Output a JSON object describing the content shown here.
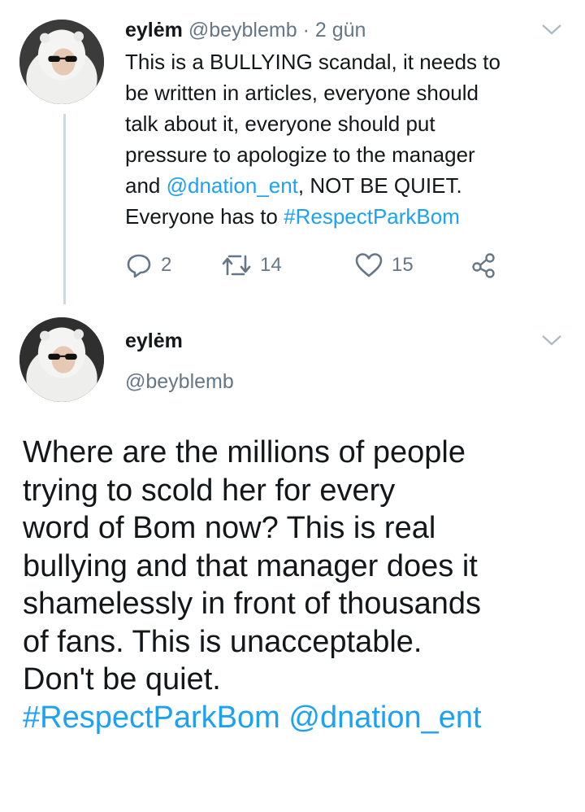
{
  "reply_tweet": {
    "display_name": "eylėm",
    "handle": "@beyblemb",
    "separator": " · ",
    "time": "2 gün",
    "text_line1": "This is a BULLYING scandal, it needs to",
    "text_line2": "be written in articles, everyone should",
    "text_line3": "talk about it, everyone should put",
    "text_line4": "pressure to apologize to the manager",
    "text_line5_pre": "and ",
    "mention": "@dnation_ent",
    "text_line5_post": ", NOT BE QUIET.",
    "text_line6_pre": "Everyone has to ",
    "hashtag": "#RespectParkBom",
    "replies": "2",
    "retweets": "14",
    "likes": "15"
  },
  "main_tweet": {
    "display_name": "eylėm",
    "handle": "@beyblemb",
    "line1": "Where are the millions of people",
    "line2": "trying to scold her for every",
    "line3": "word of Bom now? This is real",
    "line4": "bullying and that manager does it",
    "line5": "shamelessly in front of thousands",
    "line6": "of fans. This is unacceptable.",
    "line7": "Don't be quiet.",
    "hashtag": "#RespectParkBom",
    "mention": "@dnation_ent"
  },
  "icons": {
    "reply": "reply-icon",
    "retweet": "retweet-icon",
    "like": "heart-icon",
    "share": "share-icon",
    "menu": "chevron-down-icon"
  },
  "colors": {
    "link": "#1da1f2",
    "muted": "#657786",
    "text": "#14171a",
    "thread_line": "#cfd9de"
  }
}
